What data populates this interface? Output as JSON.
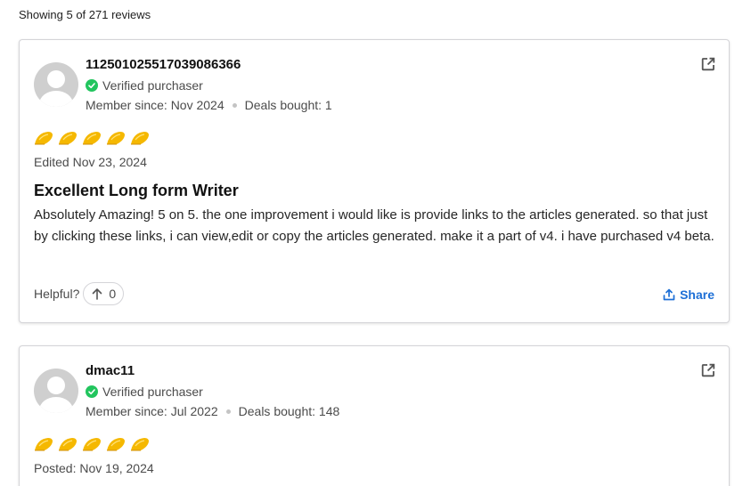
{
  "summary": "Showing 5 of 271 reviews",
  "colors": {
    "accent": "#1d6fd6",
    "verified": "#22c55e",
    "star": "#f5b800"
  },
  "reviews": [
    {
      "username": "112501025517039086366",
      "verified_label": "Verified purchaser",
      "member_since": "Member since: Nov 2024",
      "deals_bought": "Deals bought: 1",
      "rating": 5,
      "date": "Edited Nov 23, 2024",
      "title": "Excellent Long form Writer",
      "body": "Absolutely Amazing! 5 on 5. the one improvement i would like is provide links to the articles generated. so that just by clicking these links, i can view,edit or copy the articles generated. make it a part of v4. i have purchased v4 beta.",
      "helpful_label": "Helpful?",
      "helpful_count": "0",
      "share_label": "Share"
    },
    {
      "username": "dmac11",
      "verified_label": "Verified purchaser",
      "member_since": "Member since: Jul 2022",
      "deals_bought": "Deals bought: 148",
      "rating": 5,
      "date": "Posted: Nov 19, 2024"
    }
  ]
}
